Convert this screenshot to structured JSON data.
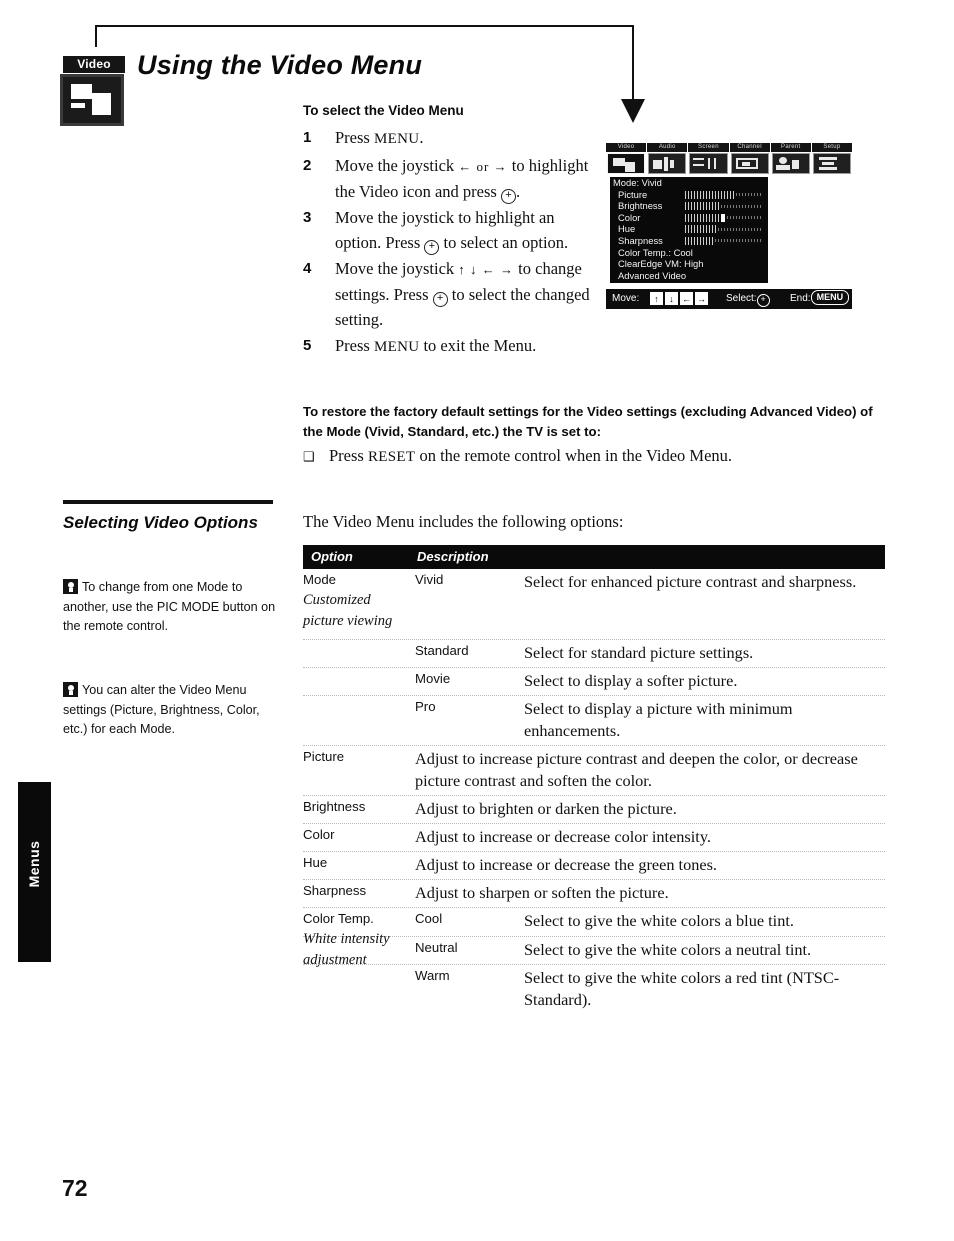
{
  "page": {
    "number": "72",
    "thumb_tab_label": "Menus"
  },
  "header": {
    "badge_caption": "Video",
    "badge_icon": "video-mode-icon",
    "title": "Using the Video Menu",
    "callout_icon": "callout-arrow-icon"
  },
  "procedure": {
    "subhead": "To select the Video Menu",
    "steps": [
      {
        "num": "1",
        "text_before": "Press ",
        "smallcaps": "MENU",
        "text_after": "."
      },
      {
        "num": "2",
        "text_before": "Move the joystick ",
        "arrows": "← or →",
        "text_after": " to highlight the Video icon and press ",
        "ring": "+",
        "tail": "."
      },
      {
        "num": "3",
        "text_before": "Move the joystick to highlight an option. Press ",
        "ring": "+",
        "text_after": " to select an option."
      },
      {
        "num": "4",
        "text_before": "Move the joystick ",
        "arrows": "↑ ↓ ← →",
        "text_after": " to change settings. Press ",
        "ring": "+",
        "tail": " to select the changed setting."
      },
      {
        "num": "5",
        "text_before": "Press ",
        "smallcaps": "MENU",
        "text_after": " to exit the Menu."
      }
    ]
  },
  "restore": {
    "note": "To restore the factory default settings for the Video settings (excluding Advanced Video) of the Mode (Vivid, Standard, etc.) the TV is set to:",
    "bullet_glyph": "❑",
    "item_before": "Press ",
    "item_smallcaps": "RESET",
    "item_after": " on the remote control when in the Video Menu."
  },
  "tv_menu": {
    "tabs": [
      {
        "label": "Video",
        "icon": "video-tab-icon",
        "selected": true
      },
      {
        "label": "Audio",
        "icon": "audio-tab-icon",
        "selected": false
      },
      {
        "label": "Screen",
        "icon": "screen-tab-icon",
        "selected": false
      },
      {
        "label": "Channel",
        "icon": "channel-tab-icon",
        "selected": false
      },
      {
        "label": "Parent",
        "icon": "parent-tab-icon",
        "selected": false
      },
      {
        "label": "Setup",
        "icon": "setup-tab-icon",
        "selected": false
      }
    ],
    "rows": [
      {
        "name": "Mode: Vivid",
        "type": "text"
      },
      {
        "name": "Picture",
        "type": "bar",
        "fill": 62
      },
      {
        "name": "Brightness",
        "type": "bar",
        "fill": 45
      },
      {
        "name": "Color",
        "type": "bar",
        "fill": 50
      },
      {
        "name": "Hue",
        "type": "bar",
        "fill": 40
      },
      {
        "name": "Sharpness",
        "type": "bar",
        "fill": 38
      },
      {
        "name": "Color Temp.: Cool",
        "type": "text"
      },
      {
        "name": "ClearEdge VM: High",
        "type": "text"
      },
      {
        "name": "Advanced Video",
        "type": "text"
      }
    ],
    "footer": {
      "move_label": "Move:",
      "keys": [
        "↑",
        "↓",
        "←",
        "→"
      ],
      "select_label": "Select:",
      "select_glyph": "+",
      "end_label": "End:",
      "end_button": "MENU"
    }
  },
  "sidebar": {
    "heading": "Selecting Video Options",
    "tips": [
      {
        "icon": "lightbulb-tip-icon",
        "text": "To change from one Mode to another, use the PIC MODE button on the remote control."
      },
      {
        "icon": "lightbulb-tip-icon",
        "text": "You can alter the Video Menu settings (Picture, Brightness, Color, etc.) for each Mode."
      }
    ]
  },
  "table": {
    "intro": "The Video Menu includes the following options:",
    "headers": {
      "option": "Option",
      "description": "Description"
    },
    "rows": [
      {
        "option": "Mode",
        "option_sub": "Customized picture viewing",
        "value": "Vivid",
        "description": "Select for enhanced picture contrast and sharpness.",
        "layout": "three-col"
      },
      {
        "option": "",
        "value": "Standard",
        "description": "Select for standard picture settings.",
        "layout": "three-col"
      },
      {
        "option": "",
        "value": "Movie",
        "description": "Select to display a softer picture.",
        "layout": "three-col"
      },
      {
        "option": "",
        "value": "Pro",
        "description": "Select to display a picture with minimum enhancements.",
        "layout": "three-col"
      },
      {
        "option": "Picture",
        "value": "",
        "description": "Adjust to increase picture contrast and deepen the color, or decrease picture contrast and soften the color.",
        "layout": "two-col"
      },
      {
        "option": "Brightness",
        "value": "",
        "description": "Adjust to brighten or darken the picture.",
        "layout": "two-col"
      },
      {
        "option": "Color",
        "value": "",
        "description": "Adjust to increase or decrease color intensity.",
        "layout": "two-col"
      },
      {
        "option": "Hue",
        "value": "",
        "description": "Adjust to increase or decrease the green tones.",
        "layout": "two-col"
      },
      {
        "option": "Sharpness",
        "value": "",
        "description": "Adjust to sharpen or soften the picture.",
        "layout": "two-col"
      },
      {
        "option": "Color Temp.",
        "option_sub": "White intensity adjustment",
        "value": "Cool",
        "description": "Select to give the white colors a blue tint.",
        "layout": "three-col"
      },
      {
        "option": "",
        "value": "Neutral",
        "description": "Select to give the white colors a neutral tint.",
        "layout": "three-col"
      },
      {
        "option": "",
        "value": "Warm",
        "description": "Select to give the white colors a red tint (NTSC-Standard).",
        "layout": "three-col"
      }
    ]
  }
}
